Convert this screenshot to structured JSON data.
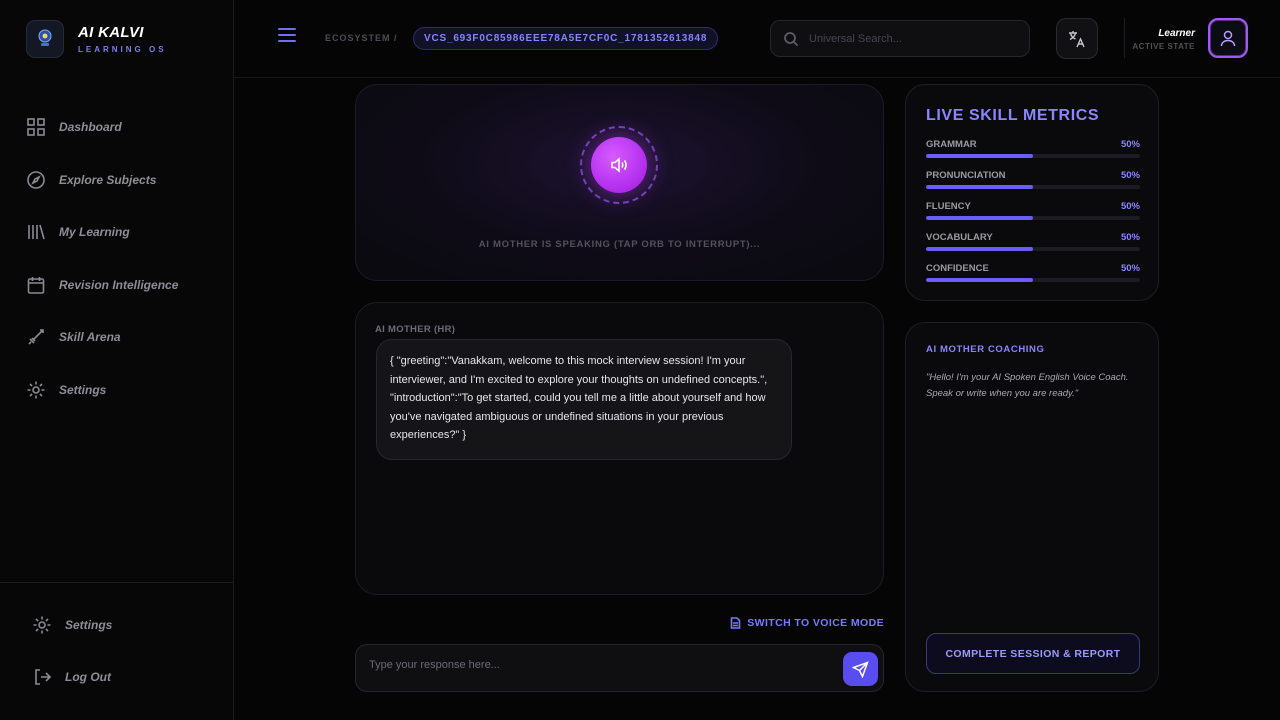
{
  "brand": {
    "title": "AI KALVI",
    "subtitle": "LEARNING OS"
  },
  "sidebar": {
    "items": [
      {
        "label": "Dashboard",
        "icon": "grid-icon"
      },
      {
        "label": "Explore Subjects",
        "icon": "compass-icon"
      },
      {
        "label": "My Learning",
        "icon": "library-icon"
      },
      {
        "label": "Revision Intelligence",
        "icon": "calendar-icon"
      },
      {
        "label": "Skill Arena",
        "icon": "sword-icon"
      },
      {
        "label": "Settings",
        "icon": "gear-icon"
      }
    ],
    "bottom": [
      {
        "label": "Settings",
        "icon": "gear-icon"
      },
      {
        "label": "Log Out",
        "icon": "logout-icon"
      }
    ]
  },
  "header": {
    "breadcrumb": "ECOSYSTEM /",
    "session_id": "VCS_693F0C85986EEE78A5E7CF0C_1781352613848",
    "search_placeholder": "Universal Search...",
    "user_name": "Learner",
    "user_state": "ACTIVE STATE"
  },
  "voice": {
    "status": "AI MOTHER IS SPEAKING (TAP ORB TO INTERRUPT)..."
  },
  "chat": {
    "sender": "AI MOTHER (HR)",
    "message": "{ \"greeting\":\"Vanakkam, welcome to this mock interview session! I'm your interviewer, and I'm excited to explore your thoughts on undefined concepts.\", \"introduction\":\"To get started, could you tell me a little about yourself and how you've navigated ambiguous or undefined situations in your previous experiences?\" }"
  },
  "switch_voice_label": "SWITCH TO VOICE MODE",
  "reply": {
    "placeholder": "Type your response here..."
  },
  "metrics": {
    "title": "LIVE SKILL METRICS",
    "items": [
      {
        "name": "GRAMMAR",
        "value": "50%",
        "fraction": 0.5
      },
      {
        "name": "PRONUNCIATION",
        "value": "50%",
        "fraction": 0.5
      },
      {
        "name": "FLUENCY",
        "value": "50%",
        "fraction": 0.5
      },
      {
        "name": "VOCABULARY",
        "value": "50%",
        "fraction": 0.5
      },
      {
        "name": "CONFIDENCE",
        "value": "50%",
        "fraction": 0.5
      }
    ]
  },
  "coaching": {
    "title": "AI MOTHER COACHING",
    "text": "\"Hello! I'm your AI Spoken English Voice Coach. Speak or write when you are ready.\"",
    "button": "COMPLETE SESSION & REPORT"
  },
  "colors": {
    "accent": "#7a7aff",
    "orb": "#b632ef",
    "send": "#5a4df0",
    "metric_fill": "#6a5cff"
  }
}
